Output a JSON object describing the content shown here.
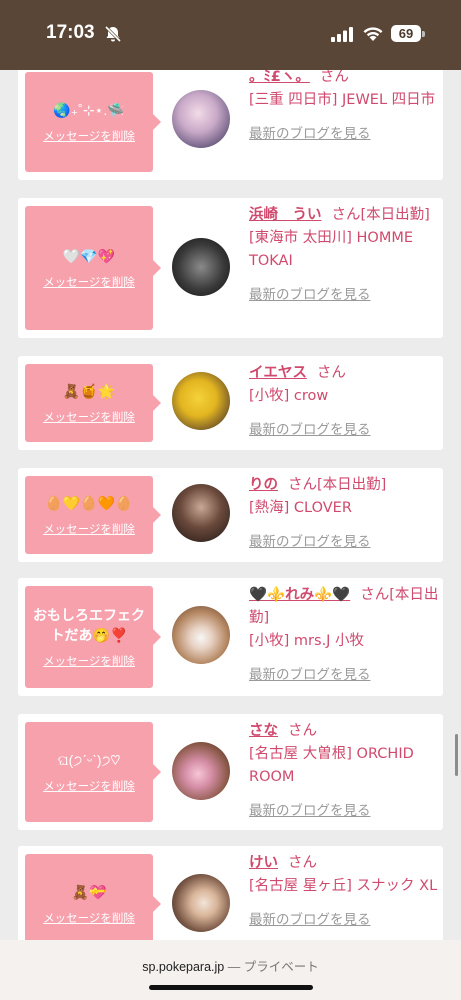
{
  "status_bar": {
    "time": "17:03",
    "battery": "69"
  },
  "messages": [
    {
      "message": "🌏₊˚⊹⋆.🛸",
      "delete_label": "メッセージを削除",
      "name": "。ﾐ£ヽ。",
      "san": "さん",
      "tag": "",
      "shop": "[三重 四日市] JEWEL 四日市",
      "blog_label": "最新のブログを見る"
    },
    {
      "message": "🤍💎💖",
      "delete_label": "メッセージを削除",
      "name": "浜崎　うい",
      "san": "さん",
      "tag": "[本日出勤]",
      "shop": "[東海市 太田川] HOMME TOKAI",
      "blog_label": "最新のブログを見る"
    },
    {
      "message": "🧸🍯🌟",
      "delete_label": "メッセージを削除",
      "name": "イエヤス",
      "san": "さん",
      "tag": "",
      "shop": "[小牧] crow",
      "blog_label": "最新のブログを見る"
    },
    {
      "message": "🥚💛🥚🧡🥚",
      "delete_label": "メッセージを削除",
      "name": "りの",
      "san": "さん",
      "tag": "[本日出勤]",
      "shop": "[熱海] CLOVER",
      "blog_label": "最新のブログを見る"
    },
    {
      "message": "おもしろエフェクトだあ🤭❣️",
      "delete_label": "メッセージを削除",
      "name": "🖤⚜️れみ⚜️🖤",
      "san": "さん",
      "tag": "[本日出勤]",
      "shop": "[小牧] mrs.J 小牧",
      "blog_label": "最新のブログを見る"
    },
    {
      "message": "ଘ(੭ˊᵕˋ)੭♡",
      "delete_label": "メッセージを削除",
      "name": "さな",
      "san": "さん",
      "tag": "",
      "shop": "[名古屋 大曽根] ORCHID ROOM",
      "blog_label": "最新のブログを見る"
    },
    {
      "message": "🧸💝",
      "delete_label": "メッセージを削除",
      "name": "けい",
      "san": "さん",
      "tag": "",
      "shop": "[名古屋 星ヶ丘] スナック XL",
      "blog_label": "最新のブログを見る"
    }
  ],
  "url_bar": {
    "host": "sp.pokepara.jp",
    "separator": " — ",
    "mode": "プライベート"
  },
  "colors": {
    "status_bar_bg": "#5a4636",
    "bubble_pink": "#f7a1ad",
    "name_pink": "#d04a6e",
    "blog_gray": "#9a9a9a"
  },
  "icons": [
    "bell-slash-icon",
    "signal-icon",
    "wifi-icon",
    "battery-icon"
  ]
}
